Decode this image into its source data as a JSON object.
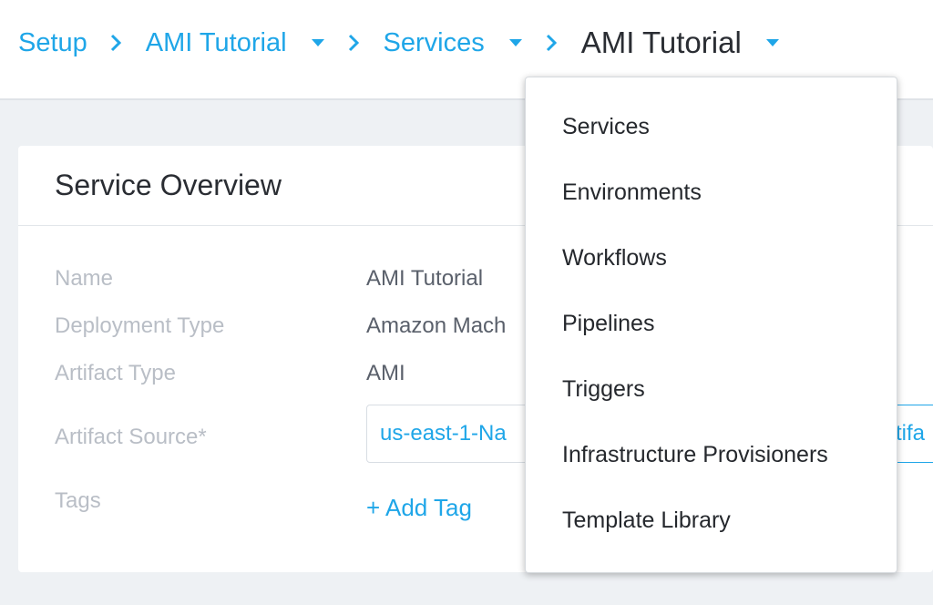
{
  "breadcrumb": {
    "setup": "Setup",
    "app": "AMI Tutorial",
    "services": "Services",
    "current": "AMI Tutorial"
  },
  "overview": {
    "title": "Service Overview",
    "fields": {
      "name_label": "Name",
      "name_value": "AMI Tutorial",
      "deployment_label": "Deployment Type",
      "deployment_value": "Amazon Mach",
      "artifact_type_label": "Artifact Type",
      "artifact_type_value": "AMI",
      "artifact_source_label": "Artifact Source*",
      "artifact_source_value": "us-east-1-Na",
      "artifact_button": "rtifa",
      "tags_label": "Tags",
      "add_tag": "+ Add Tag"
    }
  },
  "dropdown": {
    "items": [
      "Services",
      "Environments",
      "Workflows",
      "Pipelines",
      "Triggers",
      "Infrastructure Provisioners",
      "Template Library"
    ]
  },
  "colors": {
    "accent": "#1fa6e8",
    "text_dark": "#2a2d33",
    "label_gray": "#b9bec6",
    "background": "#eef1f4"
  },
  "icons": {
    "separator": "chevron-right-icon",
    "caret": "caret-down-icon"
  }
}
